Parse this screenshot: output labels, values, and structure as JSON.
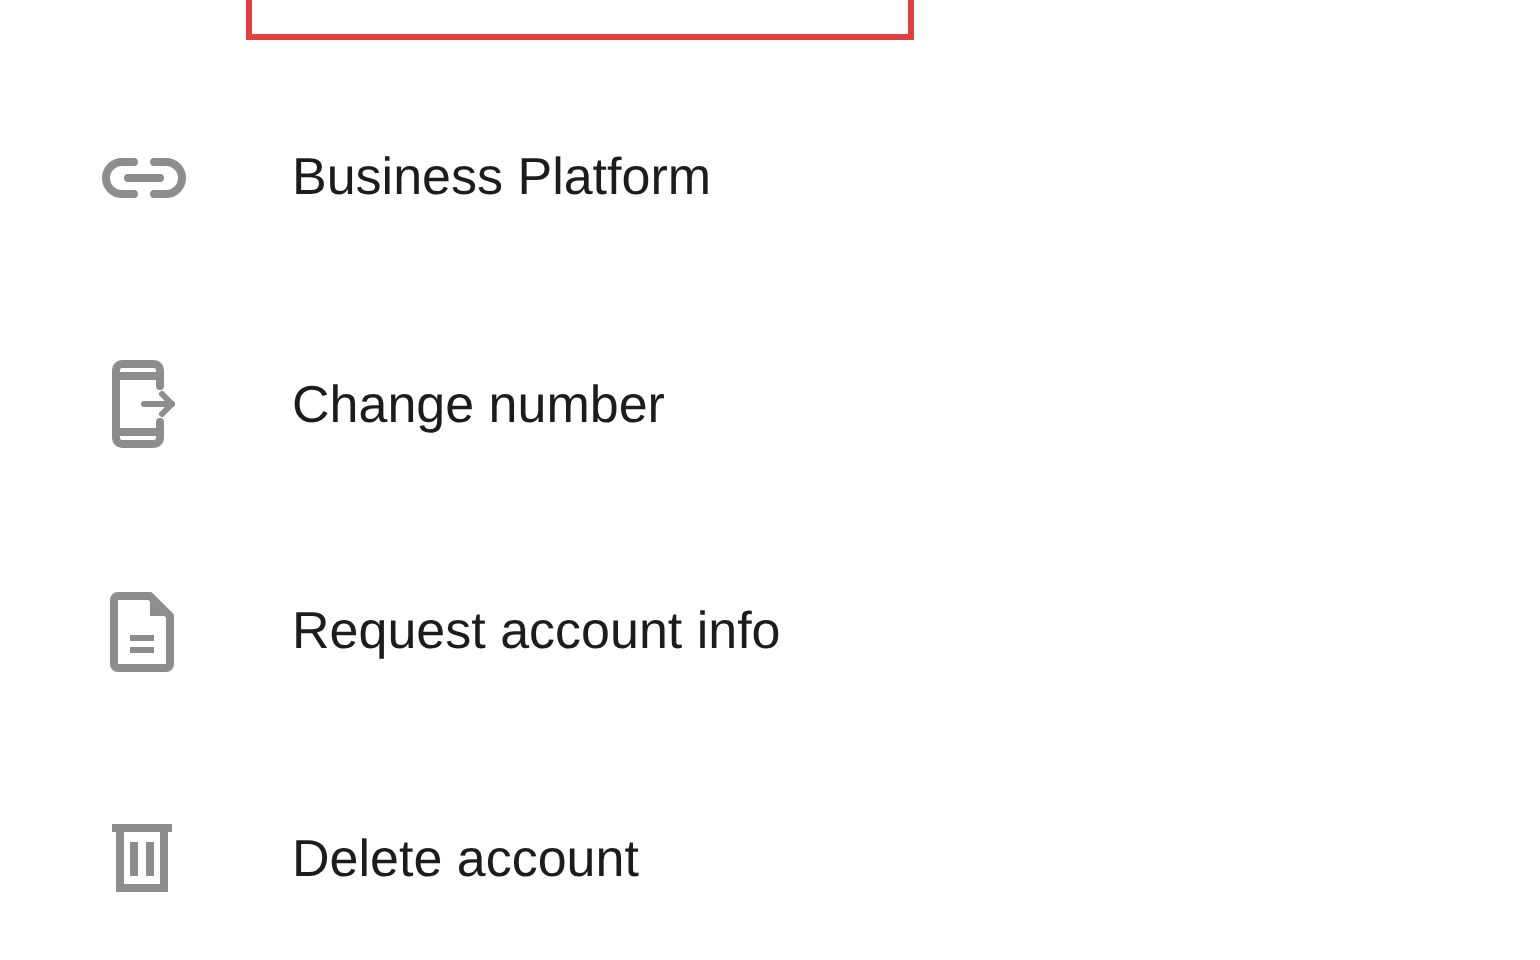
{
  "items": [
    {
      "label": "Business Platform",
      "kind": "link"
    },
    {
      "label": "Change number",
      "kind": "phone"
    },
    {
      "label": "Request account info",
      "kind": "document"
    },
    {
      "label": "Delete account",
      "kind": "trash"
    }
  ]
}
